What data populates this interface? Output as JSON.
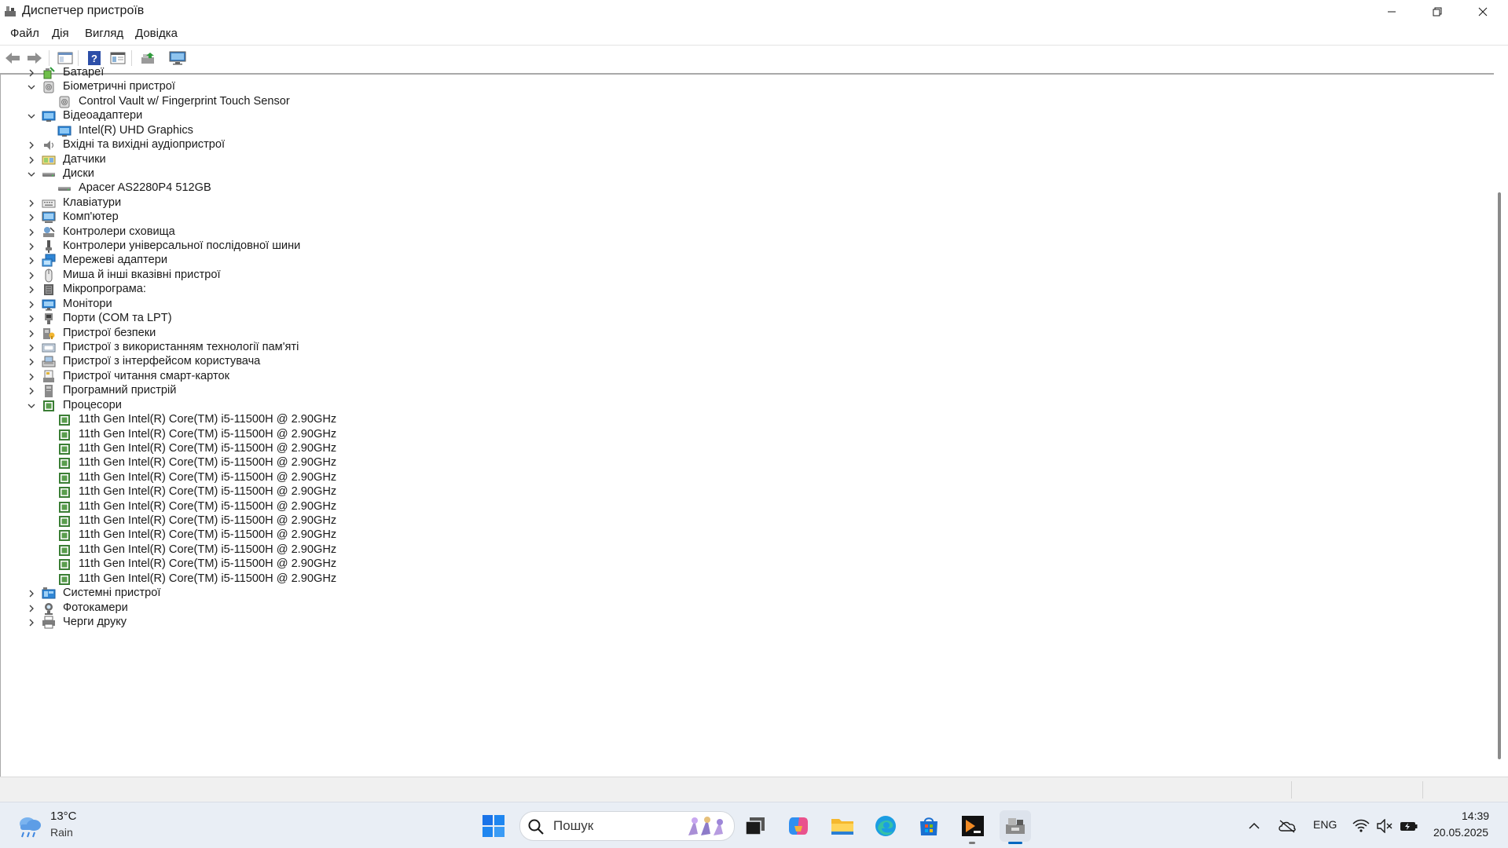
{
  "window": {
    "title": "Диспетчер пристроїв",
    "controls": [
      "minimize-icon",
      "restore-icon",
      "close-icon"
    ]
  },
  "menu": {
    "items": [
      "Файл",
      "Дія",
      "Вигляд",
      "Довідка"
    ]
  },
  "toolbar": {
    "buttons": [
      "back-icon",
      "forward-icon",
      "show-hide-console-tree-icon",
      "help-icon",
      "properties-icon",
      "update-driver-icon",
      "monitor-scan-icon"
    ]
  },
  "tree": {
    "rows": [
      {
        "label": "Батареї",
        "level": 0,
        "expander": "collapsed",
        "icon": "battery-icon"
      },
      {
        "label": "Біометричні пристрої",
        "level": 0,
        "expander": "expanded",
        "icon": "biometric-icon"
      },
      {
        "label": "Control Vault w/ Fingerprint Touch Sensor",
        "level": 1,
        "expander": "none",
        "icon": "fingerprint-device-icon"
      },
      {
        "label": "Відеоадаптери",
        "level": 0,
        "expander": "expanded",
        "icon": "display-adapter-icon"
      },
      {
        "label": "Intel(R) UHD Graphics",
        "level": 1,
        "expander": "none",
        "icon": "display-adapter-icon"
      },
      {
        "label": "Вхідні та вихідні аудіопристрої",
        "level": 0,
        "expander": "collapsed",
        "icon": "speaker-icon"
      },
      {
        "label": "Датчики",
        "level": 0,
        "expander": "collapsed",
        "icon": "sensor-icon"
      },
      {
        "label": "Диски",
        "level": 0,
        "expander": "expanded",
        "icon": "disk-drive-icon"
      },
      {
        "label": "Apacer AS2280P4 512GB",
        "level": 1,
        "expander": "none",
        "icon": "disk-drive-icon"
      },
      {
        "label": "Клавіатури",
        "level": 0,
        "expander": "collapsed",
        "icon": "keyboard-icon"
      },
      {
        "label": "Комп'ютер",
        "level": 0,
        "expander": "collapsed",
        "icon": "computer-icon"
      },
      {
        "label": "Контролери сховища",
        "level": 0,
        "expander": "collapsed",
        "icon": "storage-controller-icon"
      },
      {
        "label": "Контролери універсальної послідовної шини",
        "level": 0,
        "expander": "collapsed",
        "icon": "usb-icon"
      },
      {
        "label": "Мережеві адаптери",
        "level": 0,
        "expander": "collapsed",
        "icon": "network-adapter-icon"
      },
      {
        "label": "Миша й інші вказівні пристрої",
        "level": 0,
        "expander": "collapsed",
        "icon": "mouse-icon"
      },
      {
        "label": "Мікропрограма:",
        "level": 0,
        "expander": "collapsed",
        "icon": "firmware-icon"
      },
      {
        "label": "Монітори",
        "level": 0,
        "expander": "collapsed",
        "icon": "monitor-icon"
      },
      {
        "label": "Порти (COM та LPT)",
        "level": 0,
        "expander": "collapsed",
        "icon": "port-icon"
      },
      {
        "label": "Пристрої безпеки",
        "level": 0,
        "expander": "collapsed",
        "icon": "security-device-icon"
      },
      {
        "label": "Пристрої з використанням технології пам'яті",
        "level": 0,
        "expander": "collapsed",
        "icon": "memory-technology-icon"
      },
      {
        "label": "Пристрої з інтерфейсом користувача",
        "level": 0,
        "expander": "collapsed",
        "icon": "hid-icon"
      },
      {
        "label": "Пристрої читання смарт-карток",
        "level": 0,
        "expander": "collapsed",
        "icon": "smart-card-reader-icon"
      },
      {
        "label": "Програмний пристрій",
        "level": 0,
        "expander": "collapsed",
        "icon": "software-device-icon"
      },
      {
        "label": "Процесори",
        "level": 0,
        "expander": "expanded",
        "icon": "processor-icon"
      },
      {
        "label": "11th Gen Intel(R) Core(TM) i5-11500H @ 2.90GHz",
        "level": 1,
        "expander": "none",
        "icon": "processor-icon"
      },
      {
        "label": "11th Gen Intel(R) Core(TM) i5-11500H @ 2.90GHz",
        "level": 1,
        "expander": "none",
        "icon": "processor-icon"
      },
      {
        "label": "11th Gen Intel(R) Core(TM) i5-11500H @ 2.90GHz",
        "level": 1,
        "expander": "none",
        "icon": "processor-icon"
      },
      {
        "label": "11th Gen Intel(R) Core(TM) i5-11500H @ 2.90GHz",
        "level": 1,
        "expander": "none",
        "icon": "processor-icon"
      },
      {
        "label": "11th Gen Intel(R) Core(TM) i5-11500H @ 2.90GHz",
        "level": 1,
        "expander": "none",
        "icon": "processor-icon"
      },
      {
        "label": "11th Gen Intel(R) Core(TM) i5-11500H @ 2.90GHz",
        "level": 1,
        "expander": "none",
        "icon": "processor-icon"
      },
      {
        "label": "11th Gen Intel(R) Core(TM) i5-11500H @ 2.90GHz",
        "level": 1,
        "expander": "none",
        "icon": "processor-icon"
      },
      {
        "label": "11th Gen Intel(R) Core(TM) i5-11500H @ 2.90GHz",
        "level": 1,
        "expander": "none",
        "icon": "processor-icon"
      },
      {
        "label": "11th Gen Intel(R) Core(TM) i5-11500H @ 2.90GHz",
        "level": 1,
        "expander": "none",
        "icon": "processor-icon"
      },
      {
        "label": "11th Gen Intel(R) Core(TM) i5-11500H @ 2.90GHz",
        "level": 1,
        "expander": "none",
        "icon": "processor-icon"
      },
      {
        "label": "11th Gen Intel(R) Core(TM) i5-11500H @ 2.90GHz",
        "level": 1,
        "expander": "none",
        "icon": "processor-icon"
      },
      {
        "label": "11th Gen Intel(R) Core(TM) i5-11500H @ 2.90GHz",
        "level": 1,
        "expander": "none",
        "icon": "processor-icon"
      },
      {
        "label": "Системні пристрої",
        "level": 0,
        "expander": "collapsed",
        "icon": "system-device-icon"
      },
      {
        "label": "Фотокамери",
        "level": 0,
        "expander": "collapsed",
        "icon": "camera-icon"
      },
      {
        "label": "Черги друку",
        "level": 0,
        "expander": "collapsed",
        "icon": "print-queue-icon"
      }
    ]
  },
  "taskbar": {
    "weather": {
      "temp": "13°C",
      "condition": "Rain",
      "icon": "rain-cloud-icon"
    },
    "search": {
      "placeholder": "Пошук"
    },
    "apps": [
      "start-icon",
      "task-view-icon",
      "copilot-icon",
      "file-explorer-icon",
      "edge-icon",
      "store-icon",
      "terminal-icon",
      "device-manager-icon"
    ],
    "tray": {
      "language": "ENG",
      "time": "14:39",
      "date": "20.05.2025"
    }
  },
  "colors": {
    "accent": "#0067c0",
    "taskbar_bg": "#e9eef5",
    "statusbar_bg": "#f0f0f0",
    "processor_green": "#3a7d34"
  }
}
